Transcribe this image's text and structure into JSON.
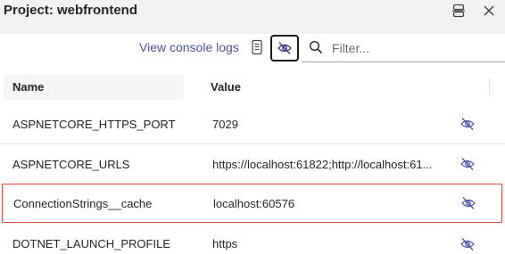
{
  "header": {
    "title": "Project: webfrontend",
    "icons": [
      "split-view-icon",
      "close-icon"
    ]
  },
  "toolbar": {
    "console_link": "View console logs",
    "filter_placeholder": "Filter...",
    "icons": [
      "document-icon",
      "eye-off-icon",
      "search-icon"
    ]
  },
  "table": {
    "columns": [
      "Name",
      "Value"
    ],
    "rows": [
      {
        "name": "ASPNETCORE_HTTPS_PORT",
        "value": "7029"
      },
      {
        "name": "ASPNETCORE_URLS",
        "value": "https://localhost:61822;http://localhost:61..."
      },
      {
        "name": "ConnectionStrings__cache",
        "value": "localhost:60576",
        "highlighted": true
      },
      {
        "name": "DOTNET_LAUNCH_PROFILE",
        "value": "https"
      }
    ]
  },
  "colors": {
    "accent_link": "#4a52a8",
    "highlight_border": "#e04b3c",
    "header_bg": "#f2f2f2"
  }
}
